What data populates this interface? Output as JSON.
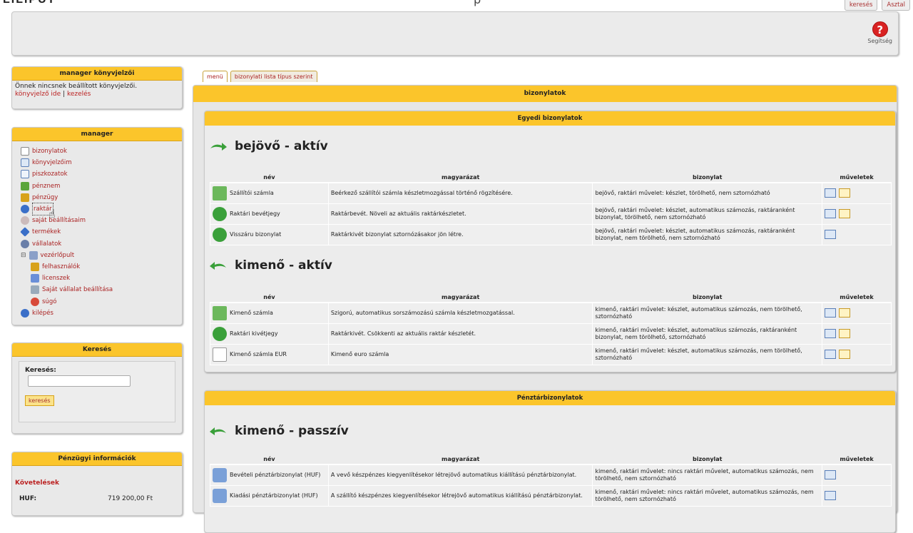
{
  "app": {
    "logo": "LILIPUT",
    "title": "p"
  },
  "top_tabs": [
    "keresés",
    "Asztal"
  ],
  "help": {
    "label": "Segítség"
  },
  "boxes": {
    "bookmarks": {
      "title": "manager könyvjelzői",
      "text": "Önnek nincsnek beállított könyvjelzői.",
      "link1": "könyvjelző ide",
      "sep": "|",
      "link2": "kezelés"
    },
    "manager": {
      "title": "manager",
      "items": [
        "bizonylatok",
        "könyvjelzőim",
        "piszkozatok",
        "pénznem",
        "pénzügy",
        "raktár",
        "saját beállításaim",
        "termékek",
        "vállalatok",
        "vezérlőpult"
      ],
      "subitems": [
        "felhasználók",
        "licenszek",
        "Saját vállalat beállítása",
        "súgó"
      ],
      "logout": "kilépés"
    },
    "search": {
      "title": "Keresés",
      "label": "Keresés:",
      "value": "",
      "button": "keresés"
    },
    "finance": {
      "title": "Pénzügyi információk",
      "subtitle": "Követelések",
      "currency": "HUF:",
      "amount": "719 200,00 Ft"
    }
  },
  "tabs": [
    "menü",
    "bizonylati lista típus szerint"
  ],
  "panel_title": "bizonylatok",
  "sections": {
    "egyedi": {
      "title": "Egyedi bizonylatok"
    },
    "penztar": {
      "title": "Pénztárbizonylatok"
    }
  },
  "columns": [
    "név",
    "magyarázat",
    "bizonylat",
    "műveletek"
  ],
  "groups": {
    "g1": {
      "title": "bejövő - aktív",
      "rows": [
        {
          "name": "Szállítói számla",
          "desc": "Beérkező szállítói számla készletmozgással történő rögzítésére.",
          "doc": "bejövő, raktári művelet: készlet, törölhető, nem sztornózható"
        },
        {
          "name": "Raktári bevétjegy",
          "desc": "Raktárbevét. Növeli az aktuális raktárkészletet.",
          "doc": "bejövő, raktári művelet: készlet, automatikus számozás, raktáranként bizonylat, törölhető, nem sztornózható"
        },
        {
          "name": "Visszáru bizonylat",
          "desc": "Raktárkivét bizonylat sztornózásakor jön létre.",
          "doc": "bejövő, raktári művelet: készlet, automatikus számozás, raktáranként bizonylat, nem törölhető, nem sztornózható"
        }
      ]
    },
    "g2": {
      "title": "kimenő - aktív",
      "rows": [
        {
          "name": "Kimenő számla",
          "desc": "Szigorú, automatikus sorszámozású számla készletmozgatással.",
          "doc": "kimenő, raktári művelet: készlet, automatikus számozás, nem törölhető, sztornózható"
        },
        {
          "name": "Raktári kivétjegy",
          "desc": "Raktárkivét. Csökkenti az aktuális raktár készletét.",
          "doc": "kimenő, raktári művelet: készlet, automatikus számozás, raktáranként bizonylat, nem törölhető, sztornózható"
        },
        {
          "name": "Kimenő számla EUR",
          "desc": "Kimenő euro számla",
          "doc": "kimenő, raktári művelet: készlet, automatikus számozás, nem törölhető, sztornózható"
        }
      ]
    },
    "g3": {
      "title": "kimenő - passzív",
      "rows": [
        {
          "name": "Bevételi pénztárbizonylat (HUF)",
          "desc": "A vevő készpénzes kiegyenlítésekor létrejövő automatikus kiállítású pénztárbizonylat.",
          "doc": "kimenő, raktári művelet: nincs raktári művelet, automatikus számozás, nem törölhető, nem sztornózható"
        },
        {
          "name": "Kiadási pénztárbizonylat (HUF)",
          "desc": "A szállító készpénzes kiegyenlítésekor létrejövő automatikus kiállítású pénztárbizonylat.",
          "doc": "kimenő, raktári művelet: nincs raktári művelet, automatikus számozás, nem törölhető, nem sztornózható"
        }
      ]
    }
  }
}
